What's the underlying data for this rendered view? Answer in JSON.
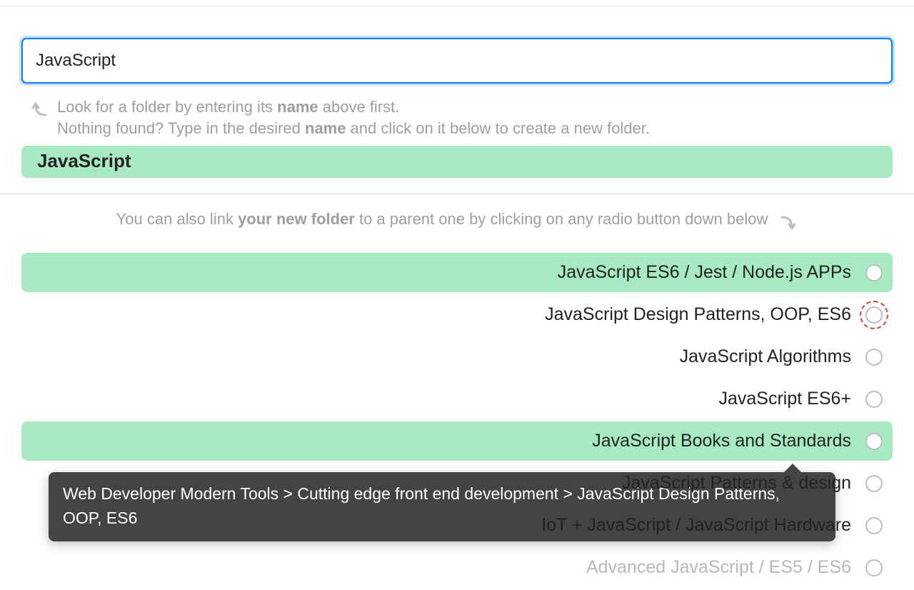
{
  "search": {
    "value": "JavaScript"
  },
  "hint": {
    "line1_pre": "Look for a folder by entering its ",
    "line1_bold": "name",
    "line1_post": " above first.",
    "line2_pre": "Nothing found? Type in the desired ",
    "line2_bold": "name",
    "line2_post": " and click on it below to create a new folder."
  },
  "new_folder": {
    "label": "JavaScript"
  },
  "link_hint": {
    "pre": "You can also link ",
    "bold": "your new folder",
    "post": " to a parent one by clicking on any radio button down below"
  },
  "folders": [
    {
      "label": "JavaScript ES6 / Jest / Node.js APPs",
      "highlight": true,
      "focus": false
    },
    {
      "label": "JavaScript Design Patterns, OOP, ES6",
      "highlight": false,
      "focus": true
    },
    {
      "label": "JavaScript Algorithms",
      "highlight": false,
      "focus": false
    },
    {
      "label": "JavaScript ES6+",
      "highlight": false,
      "focus": false
    },
    {
      "label": "JavaScript Books and Standards",
      "highlight": true,
      "focus": false
    },
    {
      "label": "JavaScript Patterns & design",
      "highlight": false,
      "focus": false
    },
    {
      "label": "IoT + JavaScript / JavaScript Hardware",
      "highlight": false,
      "focus": false
    },
    {
      "label": "Advanced JavaScript / ES5 / ES6",
      "highlight": false,
      "focus": false,
      "partial": true
    }
  ],
  "tooltip": {
    "text": "Web Developer Modern Tools > Cutting edge front end development > JavaScript Design Patterns, OOP, ES6",
    "row_index": 4
  }
}
